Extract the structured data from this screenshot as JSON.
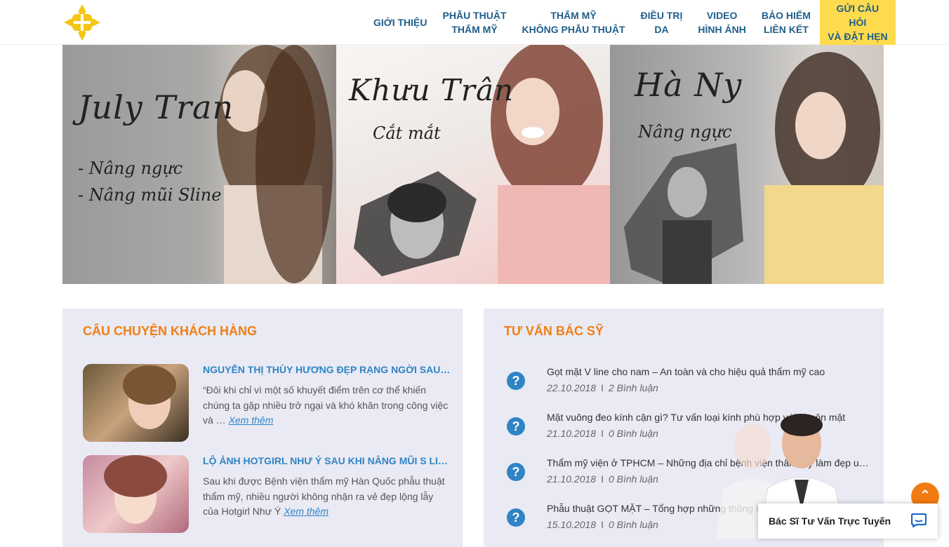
{
  "nav": {
    "items": [
      {
        "line1": "GIỚI THIỆU",
        "line2": ""
      },
      {
        "line1": "PHẪU THUẬT",
        "line2": "THẨM MỸ"
      },
      {
        "line1": "THẨM MỸ",
        "line2": "KHÔNG PHẪU THUẬT"
      },
      {
        "line1": "ĐIỀU TRỊ",
        "line2": "DA"
      },
      {
        "line1": "VIDEO",
        "line2": "HÌNH ẢNH"
      },
      {
        "line1": "BẢO HIỂM",
        "line2": "LIÊN KẾT"
      }
    ],
    "cta": {
      "line1": "GỬI CÂU HỎI",
      "line2": "VÀ ĐẶT HẸN"
    }
  },
  "banners": [
    {
      "name": "July Tran",
      "services": [
        "- Nâng ngực",
        "- Nâng mũi Sline"
      ]
    },
    {
      "name": "Khưu Trân",
      "services": [
        "Cắt mắt"
      ]
    },
    {
      "name": "Hà Ny",
      "services": [
        "Nâng ngực"
      ]
    }
  ],
  "stories": {
    "title": "CÂU CHUYỆN KHÁCH HÀNG",
    "items": [
      {
        "title": "NGUYỄN THỊ THÙY HƯƠNG ĐẸP RẠNG NGỜI SAU PHẪU THUẬT THẨM MỸ",
        "text": "“Đôi khi chỉ vì một số khuyết điểm trên cơ thể khiến chúng ta gặp nhiều trở ngại và khó khăn trong công việc và … ",
        "more": "Xem thêm"
      },
      {
        "title": "LỘ ẢNH HOTGIRL NHƯ Ý SAU KHI NÂNG MŨI S LINE",
        "text": "Sau khi được Bệnh viện thẩm mỹ Hàn Quốc phẫu thuật thẩm mỹ, nhiều người không nhận ra vẻ đẹp lộng lẫy của Hotgirl Như Ý ",
        "more": "Xem thêm"
      }
    ]
  },
  "consult": {
    "title": "TƯ VẤN BÁC SỸ",
    "items": [
      {
        "title": "Gọt mặt V line cho nam – An toàn và cho hiệu quả thẩm mỹ cao",
        "date": "22.10.2018",
        "comments": "2 Bình luận"
      },
      {
        "title": "Mặt vuông đeo kính cận gì? Tư vấn loại kính phù hợp với khuôn mặt",
        "date": "21.10.2018",
        "comments": "0 Bình luận"
      },
      {
        "title": "Thẩm mỹ viện ở TPHCM – Những địa chỉ bệnh viện thẩm mỹ làm đẹp uy tín",
        "date": "21.10.2018",
        "comments": "0 Bình luận"
      },
      {
        "title": "Phẫu thuật GỌT MẶT – Tổng hợp những thông tin cần biết",
        "date": "15.10.2018",
        "comments": "0 Bình luận"
      }
    ],
    "separator": "I"
  },
  "chat": {
    "label": "Bác Sĩ Tư Vấn Trực Tuyến"
  },
  "icons": {
    "question": "?",
    "scroll_top": "⌃"
  },
  "colors": {
    "accent": "#f07f13",
    "link": "#2f84c4",
    "nav": "#1f5f8b",
    "cta": "#fedb4c",
    "panel": "#e9eaf4"
  }
}
